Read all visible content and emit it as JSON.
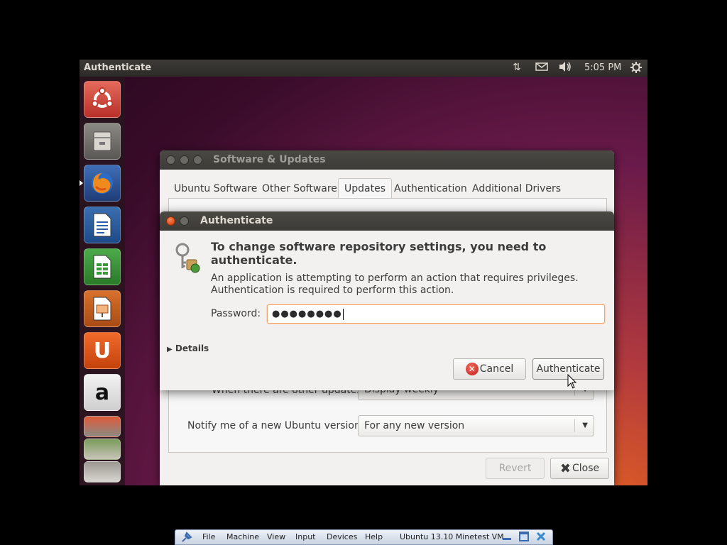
{
  "topbar": {
    "title": "Authenticate",
    "clock": "5:05 PM",
    "indicators": [
      "network-icon",
      "mail-icon",
      "volume-icon",
      "gear-icon"
    ]
  },
  "launcher": {
    "items": [
      "dash-home",
      "files",
      "firefox",
      "libreoffice-writer",
      "libreoffice-calc",
      "libreoffice-impress",
      "ubuntu-software-center",
      "amazon",
      "stacked-apps"
    ]
  },
  "main_window": {
    "title": "Software & Updates",
    "tabs": [
      "Ubuntu Software",
      "Other Software",
      "Updates",
      "Authentication",
      "Additional Drivers"
    ],
    "active_tab": "Updates",
    "other_updates_label": "When there are other updates:",
    "other_updates_value": "Display weekly",
    "notify_label": "Notify me of a new Ubuntu version:",
    "notify_value": "For any new version",
    "revert_label": "Revert",
    "close_label": "Close"
  },
  "dialog": {
    "title": "Authenticate",
    "heading": "To change software repository settings, you need to authenticate.",
    "message_line1": "An application is attempting to perform an action that requires privileges.",
    "message_line2": "Authentication is required to perform this action.",
    "password_label": "Password:",
    "password_value": "●●●●●●●●",
    "details_label": "Details",
    "cancel_label": "Cancel",
    "authenticate_label": "Authenticate"
  },
  "vbox_bar": {
    "menus": [
      "File",
      "Machine",
      "View",
      "Input",
      "Devices",
      "Help"
    ],
    "vm_name": "Ubuntu 13.10 Minetest VM"
  },
  "colors": {
    "accent": "#df4a16",
    "focus_ring": "#f0a46c",
    "titlebar": "#3c3b37"
  }
}
